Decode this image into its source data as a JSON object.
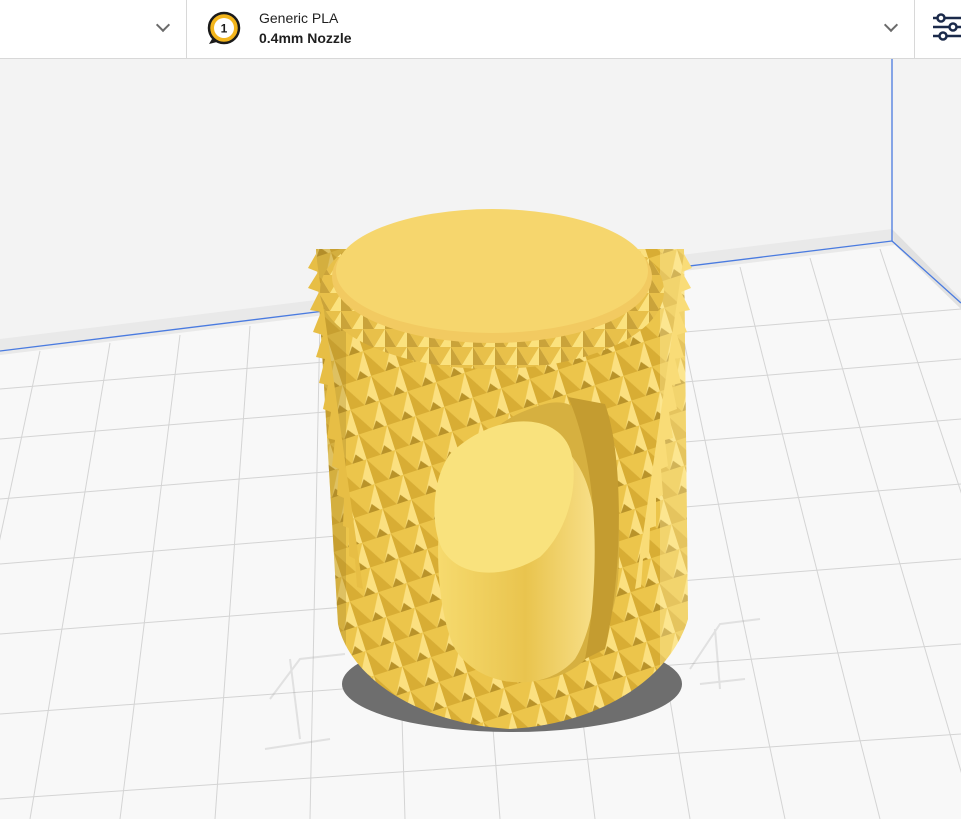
{
  "header": {
    "material": "Generic PLA",
    "nozzle": "0.4mm Nozzle",
    "extruder_number": "1",
    "left_dropdown_icon": "chevron-down-icon",
    "material_dropdown_icon": "chevron-down-icon",
    "settings_icon": "sliders-icon"
  },
  "viewport": {
    "model_color": "#f5d565",
    "build_plate_color": "#f7f7f7",
    "grid_color": "#d4d4d4",
    "axis_color": "#4a7be0"
  },
  "colors": {
    "accent": "#f3b51c",
    "dark": "#1b2a4a"
  }
}
